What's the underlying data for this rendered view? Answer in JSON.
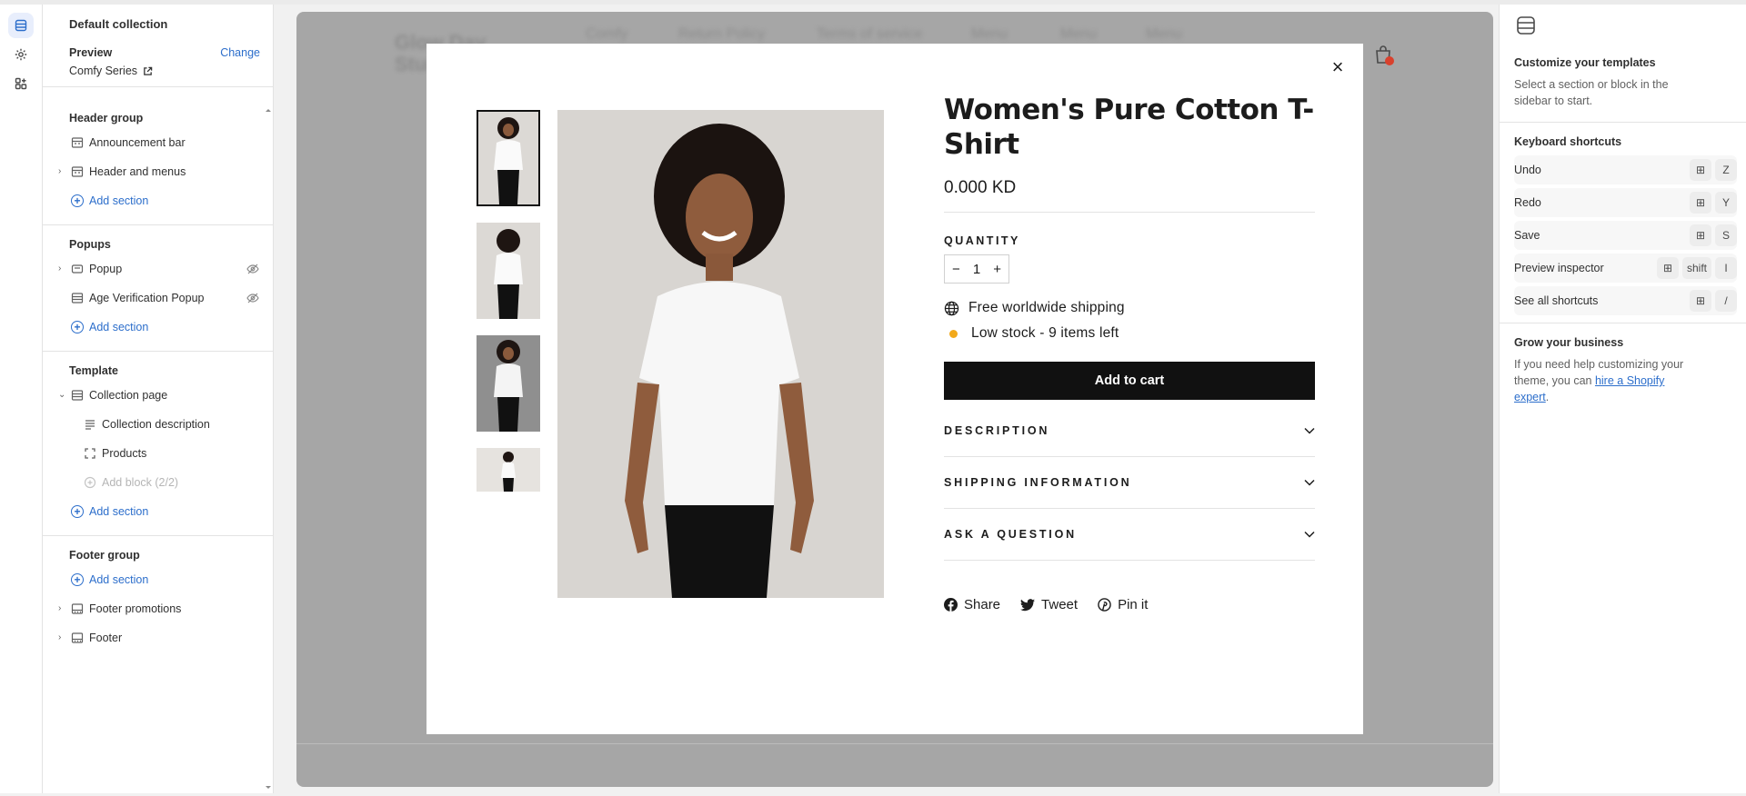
{
  "sidebar": {
    "title": "Default collection",
    "preview_label": "Preview",
    "change_label": "Change",
    "preview_value": "Comfy Series",
    "groups": {
      "header": {
        "title": "Header group",
        "items": [
          "Announcement bar",
          "Header and menus"
        ],
        "add": "Add section"
      },
      "popups": {
        "title": "Popups",
        "items": [
          "Popup",
          "Age Verification Popup"
        ],
        "add": "Add section"
      },
      "template": {
        "title": "Template",
        "page": "Collection page",
        "blocks": [
          "Collection description",
          "Products"
        ],
        "add_block": "Add block (2/2)",
        "add": "Add section"
      },
      "footer": {
        "title": "Footer group",
        "add": "Add section",
        "items": [
          "Footer promotions",
          "Footer"
        ]
      }
    }
  },
  "storefront_nav": [
    "Comfy",
    "Return Policy",
    "Terms of service",
    "Menu",
    "Menu",
    "Menu"
  ],
  "product": {
    "title": "Women's Pure Cotton T-Shirt",
    "price": "0.000 KD",
    "quantity_label": "QUANTITY",
    "quantity": "1",
    "minus": "−",
    "plus": "+",
    "shipping": "Free worldwide shipping",
    "stock": "Low stock - 9 items left",
    "add_to_cart": "Add to cart",
    "accordions": [
      "DESCRIPTION",
      "SHIPPING INFORMATION",
      "ASK A QUESTION"
    ],
    "share": [
      "Share",
      "Tweet",
      "Pin it"
    ],
    "close": "×"
  },
  "rpanel": {
    "title": "Customize your templates",
    "text": "Select a section or block in the sidebar to start.",
    "shortcuts_title": "Keyboard shortcuts",
    "shortcuts": [
      {
        "label": "Undo",
        "key": "Z"
      },
      {
        "label": "Redo",
        "key": "Y"
      },
      {
        "label": "Save",
        "key": "S"
      },
      {
        "label": "Preview inspector",
        "key1": "shift",
        "key": "I"
      },
      {
        "label": "See all shortcuts",
        "key": "/"
      }
    ],
    "grow_title": "Grow your business",
    "grow_text": "If you need help customizing your theme, you can ",
    "grow_link": "hire a Shopify expert",
    "grow_end": "."
  },
  "colors": {
    "accent": "#2c6ecb",
    "stock_dot": "#f2a91b",
    "cart_badge": "#d9412d"
  }
}
